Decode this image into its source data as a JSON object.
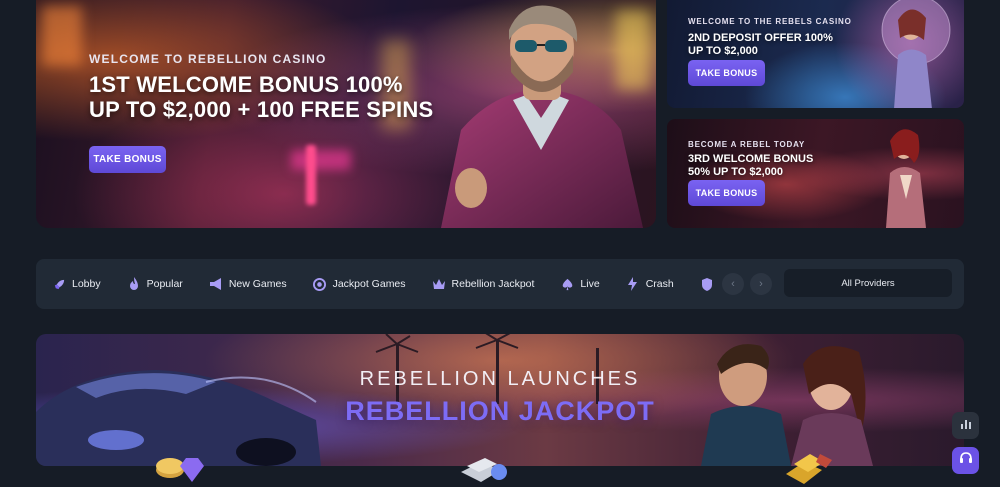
{
  "hero": {
    "kicker": "WELCOME TO REBELLION CASINO",
    "title": "1ST WELCOME BONUS 100%\nUP TO $2,000 + 100 FREE SPINS",
    "button": "TAKE BONUS"
  },
  "side_banners": [
    {
      "kicker": "WELCOME TO THE REBELS CASINO",
      "title": "2ND DEPOSIT OFFER 100%\nUP TO $2,000",
      "button": "TAKE BONUS"
    },
    {
      "kicker": "BECOME A REBEL TODAY",
      "title": "3RD WELCOME BONUS\n50% UP TO $2,000",
      "button": "TAKE BONUS"
    }
  ],
  "categories": {
    "items": [
      {
        "label": "Lobby",
        "icon": "rocket-icon"
      },
      {
        "label": "Popular",
        "icon": "flame-icon"
      },
      {
        "label": "New Games",
        "icon": "megaphone-icon"
      },
      {
        "label": "Jackpot Games",
        "icon": "coin-icon"
      },
      {
        "label": "Rebellion Jackpot",
        "icon": "crown-icon"
      },
      {
        "label": "Live",
        "icon": "spade-icon"
      },
      {
        "label": "Crash",
        "icon": "lightning-icon"
      }
    ],
    "providers_label": "All Providers"
  },
  "jackpot": {
    "subtitle": "REBELLION LAUNCHES",
    "title": "REBELLION JACKPOT"
  },
  "colors": {
    "background": "#161c26",
    "accent": "#7a63f2",
    "panel": "#212a36",
    "jackpot_title": "#7d6cf5"
  }
}
